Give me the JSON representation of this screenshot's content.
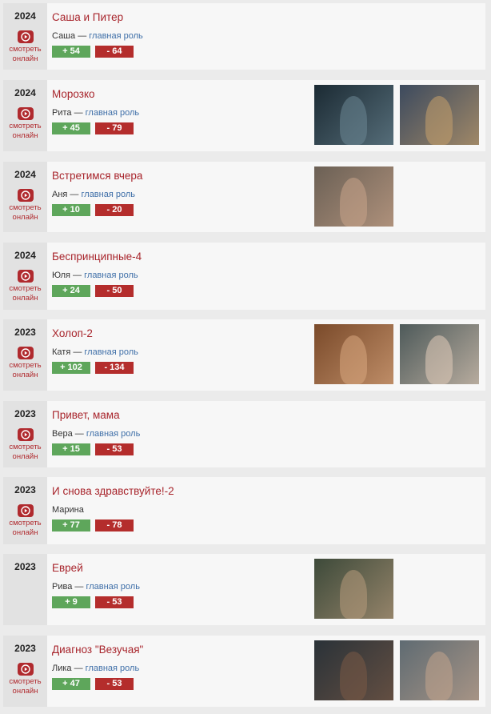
{
  "watch_label": "смотреть онлайн",
  "role_separator": "—",
  "films": [
    {
      "year": "2024",
      "title": "Саша и Питер",
      "character": "Саша",
      "role_type": "главная роль",
      "plus": "+ 54",
      "minus": "- 64",
      "watch": true,
      "thumbs": []
    },
    {
      "year": "2024",
      "title": "Морозко",
      "character": "Рита",
      "role_type": "главная роль",
      "plus": "+ 45",
      "minus": "- 79",
      "watch": true,
      "thumbs": [
        {
          "bg": "#1b2a33",
          "accent": "#6c8794"
        },
        {
          "bg": "#3c4a5e",
          "accent": "#c7a06b"
        }
      ]
    },
    {
      "year": "2024",
      "title": "Встретимся вчера",
      "character": "Аня",
      "role_type": "главная роль",
      "plus": "+ 10",
      "minus": "- 20",
      "watch": true,
      "thumbs": [
        {
          "bg": "#6b6055",
          "accent": "#c9a48a"
        }
      ]
    },
    {
      "year": "2024",
      "title": "Беспринципные-4",
      "character": "Юля",
      "role_type": "главная роль",
      "plus": "+ 24",
      "minus": "- 50",
      "watch": true,
      "thumbs": []
    },
    {
      "year": "2023",
      "title": "Холоп-2",
      "character": "Катя",
      "role_type": "главная роль",
      "plus": "+ 102",
      "minus": "- 134",
      "watch": true,
      "thumbs": [
        {
          "bg": "#7a4a2a",
          "accent": "#d9a77f"
        },
        {
          "bg": "#4e5a5a",
          "accent": "#e1ccb9"
        }
      ]
    },
    {
      "year": "2023",
      "title": "Привет, мама",
      "character": "Вера",
      "role_type": "главная роль",
      "plus": "+ 15",
      "minus": "- 53",
      "watch": true,
      "thumbs": []
    },
    {
      "year": "2023",
      "title": "И снова здравствуйте!-2",
      "character": "Марина",
      "role_type": "",
      "plus": "+ 77",
      "minus": "- 78",
      "watch": true,
      "thumbs": []
    },
    {
      "year": "2023",
      "title": "Еврей",
      "character": "Рива",
      "role_type": "главная роль",
      "plus": "+ 9",
      "minus": "- 53",
      "watch": false,
      "thumbs": [
        {
          "bg": "#3d4a3a",
          "accent": "#b79a7c"
        }
      ]
    },
    {
      "year": "2023",
      "title": "Диагноз \"Везучая\"",
      "character": "Лика",
      "role_type": "главная роль",
      "plus": "+ 47",
      "minus": "- 53",
      "watch": true,
      "thumbs": [
        {
          "bg": "#2a3238",
          "accent": "#7a5a46"
        },
        {
          "bg": "#5f6b72",
          "accent": "#c3a48d"
        }
      ]
    }
  ]
}
